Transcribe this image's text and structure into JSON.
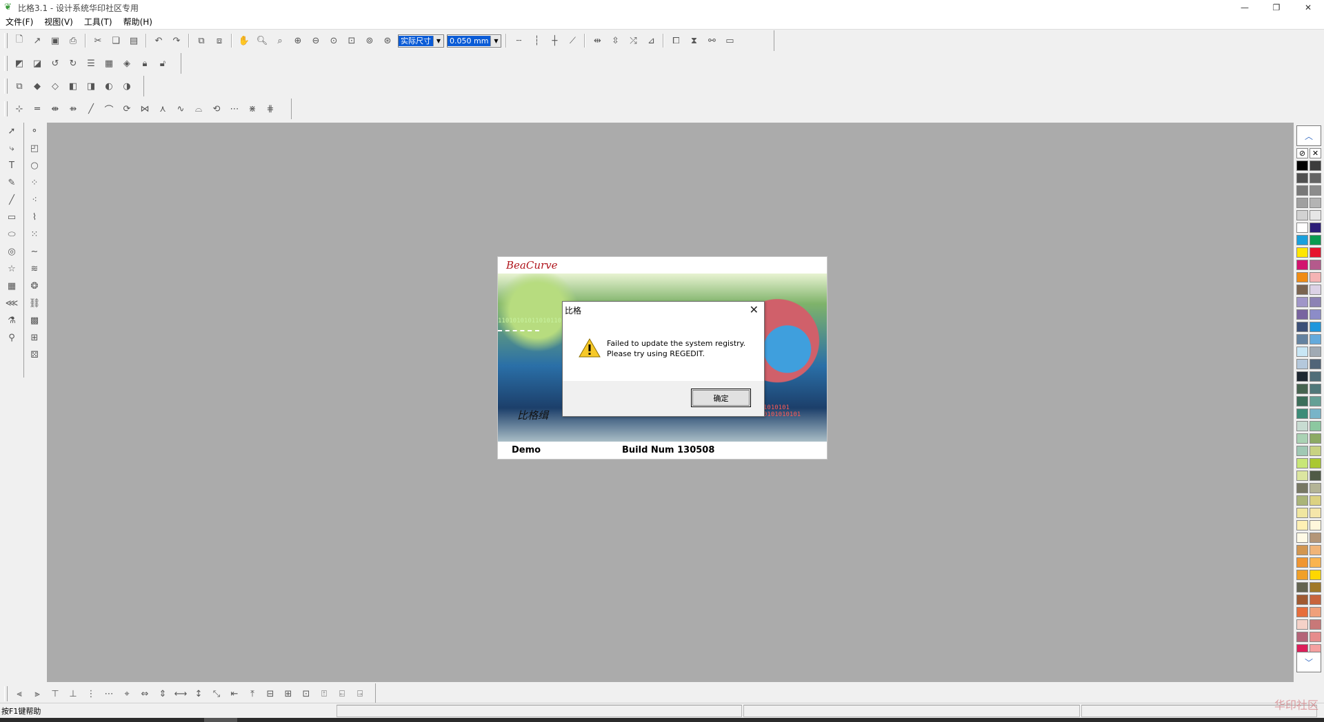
{
  "window": {
    "title": "比格3.1 - 设计系统华印社区专用"
  },
  "menu": [
    {
      "label": "文件(F)"
    },
    {
      "label": "视图(V)"
    },
    {
      "label": "工具(T)"
    },
    {
      "label": "帮助(H)"
    }
  ],
  "toolbar": {
    "size_combo": "实际尺寸",
    "line_width_combo": "0.050 mm"
  },
  "splash": {
    "logo": "BeaCurve",
    "binary_top": "110101010110101101",
    "binary_bottom": "1010101 0101010101",
    "cn_text": "比格缉",
    "edition": "Demo",
    "build": "Build Num 130508"
  },
  "dialog": {
    "title": "比格",
    "message_line1": "Failed to update the system registry.",
    "message_line2": "Please try using REGEDIT.",
    "ok_label": "确定"
  },
  "statusbar": {
    "help_text": "按F1键帮助"
  },
  "watermark": "华印社区",
  "palette_colors": [
    "#000000",
    "#3c3c3c",
    "#505050",
    "#646464",
    "#787878",
    "#8c8c8c",
    "#a0a0a0",
    "#b4b4b4",
    "#d2d2d2",
    "#e6e6e6",
    "#ffffff",
    "#2d1e78",
    "#1aa0dc",
    "#0a9a50",
    "#ffe600",
    "#e6142d",
    "#d2146e",
    "#b45a8c",
    "#f08c14",
    "#f5b4b4",
    "#7a6450",
    "#dcd2e6",
    "#a096c8",
    "#8c82b4",
    "#7864a0",
    "#8c8cc8",
    "#3c5078",
    "#1e96dc",
    "#6482a0",
    "#64aadc",
    "#c8e6f5",
    "#a0aab4",
    "#b4c8dc",
    "#506478",
    "#1e2832",
    "#506e78",
    "#466450",
    "#50787a",
    "#3c6e5a",
    "#64a096",
    "#3c8c78",
    "#78b4c8",
    "#c8dcd2",
    "#8cc8a0",
    "#aad2b4",
    "#8caa64",
    "#a0c8b4",
    "#c8d282",
    "#c8e678",
    "#aac832",
    "#dce6a0",
    "#505a46",
    "#787864",
    "#b4b496",
    "#aab478",
    "#dcd282",
    "#f0e6a0",
    "#f5e6aa",
    "#fff0b4",
    "#fff8dc",
    "#fffae6",
    "#b49678",
    "#d29650",
    "#f0b478",
    "#f09632",
    "#fab450",
    "#f0a028",
    "#ffd700",
    "#646450",
    "#a07828",
    "#a05a32",
    "#c8643c",
    "#e66e3c",
    "#f0a07a",
    "#f5d2c8",
    "#c87878",
    "#b46478",
    "#e68c8c",
    "#dc1e5a",
    "#f5a0a0"
  ]
}
